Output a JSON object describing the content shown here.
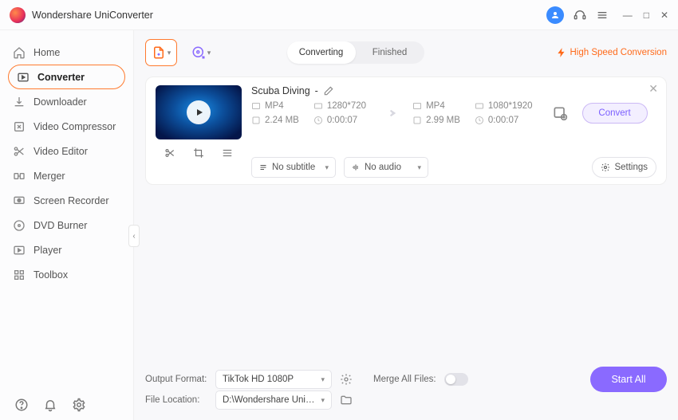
{
  "app": {
    "title": "Wondershare UniConverter"
  },
  "sidebar": {
    "items": [
      {
        "label": "Home",
        "icon": "home-icon"
      },
      {
        "label": "Converter",
        "icon": "converter-icon",
        "active": true
      },
      {
        "label": "Downloader",
        "icon": "download-icon"
      },
      {
        "label": "Video Compressor",
        "icon": "compress-icon"
      },
      {
        "label": "Video Editor",
        "icon": "scissors-icon"
      },
      {
        "label": "Merger",
        "icon": "merge-icon"
      },
      {
        "label": "Screen Recorder",
        "icon": "record-icon"
      },
      {
        "label": "DVD Burner",
        "icon": "disc-icon"
      },
      {
        "label": "Player",
        "icon": "play-icon"
      },
      {
        "label": "Toolbox",
        "icon": "grid-icon"
      }
    ]
  },
  "tabs": {
    "converting": "Converting",
    "finished": "Finished",
    "active": "converting"
  },
  "highspeed": "High Speed Conversion",
  "file": {
    "title": "Scuba Diving",
    "dash": "-",
    "src": {
      "format": "MP4",
      "res": "1280*720",
      "size": "2.24 MB",
      "dur": "0:00:07"
    },
    "dst": {
      "format": "MP4",
      "res": "1080*1920",
      "size": "2.99 MB",
      "dur": "0:00:07"
    },
    "subtitle": "No subtitle",
    "audio": "No audio",
    "settings_label": "Settings",
    "convert_label": "Convert"
  },
  "footer": {
    "output_format_label": "Output Format:",
    "output_format_value": "TikTok HD 1080P",
    "file_location_label": "File Location:",
    "file_location_value": "D:\\Wondershare UniConverter",
    "merge_label": "Merge All Files:",
    "start_all": "Start All"
  }
}
